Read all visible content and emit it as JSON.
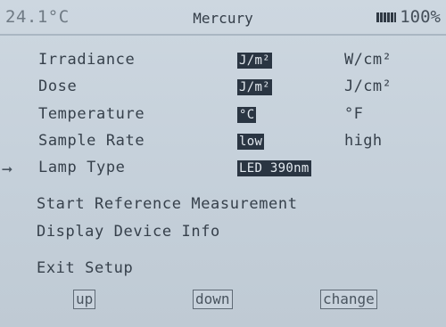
{
  "status_bar": {
    "temperature": "24.1°C",
    "title": "Mercury",
    "battery": "100%"
  },
  "settings": [
    {
      "label": "Irradiance",
      "selected": "J/m²",
      "alternate": "W/cm²"
    },
    {
      "label": "Dose",
      "selected": "J/m²",
      "alternate": "J/cm²"
    },
    {
      "label": "Temperature",
      "selected": "°C",
      "alternate": "°F"
    },
    {
      "label": "Sample Rate",
      "selected": "low",
      "alternate": "high"
    },
    {
      "label": "Lamp Type",
      "selected": "LED 390nm",
      "alternate": ""
    }
  ],
  "actions": {
    "start_reference": "Start Reference Measurement",
    "display_info": "Display Device Info",
    "exit": "Exit Setup"
  },
  "softkeys": {
    "up": "up",
    "down": "down",
    "change": "change"
  },
  "cursor_glyph": "➞"
}
